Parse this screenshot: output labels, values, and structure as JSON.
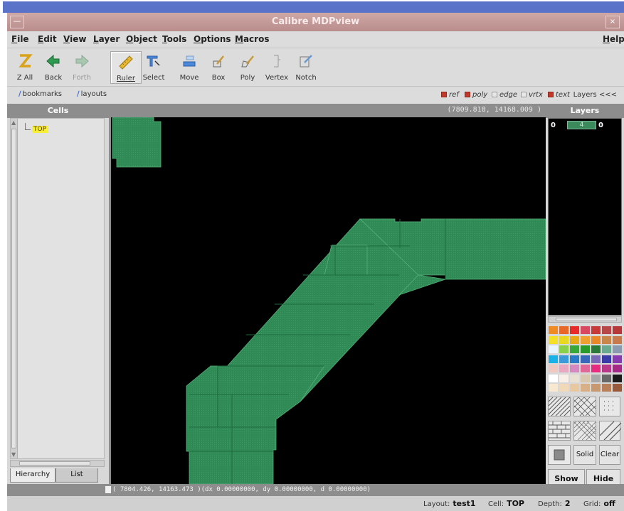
{
  "window": {
    "title": "Calibre MDPview",
    "system_menu_glyph": "—",
    "close_glyph": "×"
  },
  "menu": [
    "File",
    "Edit",
    "View",
    "Layer",
    "Object",
    "Tools",
    "Options",
    "Macros"
  ],
  "menu_help": "Help",
  "toolbar": {
    "zall": "Z All",
    "back": "Back",
    "forth": "Forth",
    "ruler": "Ruler",
    "select": "Select",
    "move": "Move",
    "box": "Box",
    "poly": "Poly",
    "vertex": "Vertex",
    "notch": "Notch"
  },
  "links": {
    "bookmarks": "bookmarks",
    "layouts": "layouts"
  },
  "filters": [
    {
      "label": "ref",
      "on": true
    },
    {
      "label": "poly",
      "on": true
    },
    {
      "label": "edge",
      "on": false
    },
    {
      "label": "vrtx",
      "on": false
    },
    {
      "label": "text",
      "on": true
    }
  ],
  "layers_toggle": "Layers <<<",
  "cells": {
    "header": "Cells",
    "top_cell": "TOP",
    "tab_hierarchy": "Hierarchy",
    "tab_list": "List"
  },
  "coords": {
    "top_readout": "(7809.818,  14168.009 )"
  },
  "layers": {
    "header": "Layers",
    "left_num": "0",
    "swatch_label": "4",
    "right_num": "0"
  },
  "layer_color": "#2f8a55",
  "palette": [
    [
      "#f08a22",
      "#e8682a",
      "#e82a2a",
      "#d84860",
      "#c83a3a",
      "#b84848",
      "#b83838"
    ],
    [
      "#f4e028",
      "#e8d820",
      "#e8a818",
      "#f0a030",
      "#e88828",
      "#c8864a",
      "#c87a4a"
    ],
    [
      "#e8f4ff",
      "#8ad04a",
      "#38a838",
      "#2a9a2a",
      "#2a7a3a",
      "#6aa890",
      "#8a9ab0"
    ],
    [
      "#1ab0e8",
      "#3a9ad8",
      "#2a7ac8",
      "#3a68b8",
      "#7a68b8",
      "#3a3aa8",
      "#8a3ab0"
    ],
    [
      "#f0c8c0",
      "#e8a8c0",
      "#d888c0",
      "#e06898",
      "#e82a80",
      "#b8388a",
      "#a82888"
    ],
    [
      "#ffffff",
      "#f8f0e8",
      "#e8e0d0",
      "#d8c8b0",
      "#a8a8a8",
      "#686868",
      "#1a1a1a"
    ],
    [
      "#f8e8d0",
      "#f0d8b8",
      "#e8c8a0",
      "#d8b088",
      "#c89870",
      "#b8805a",
      "#985a3a"
    ]
  ],
  "layer_buttons": {
    "solid": "Solid",
    "clear": "Clear",
    "show": "Show",
    "hide": "Hide"
  },
  "cursor_status": "( 7804.426,  14163.473 )(dx 0.00000000, dy 0.00000000, d 0.00000000)",
  "status": {
    "layout_label": "Layout:",
    "layout_value": "test1",
    "cell_label": "Cell:",
    "cell_value": "TOP",
    "depth_label": "Depth:",
    "depth_value": "2",
    "grid_label": "Grid:",
    "grid_value": "off"
  }
}
